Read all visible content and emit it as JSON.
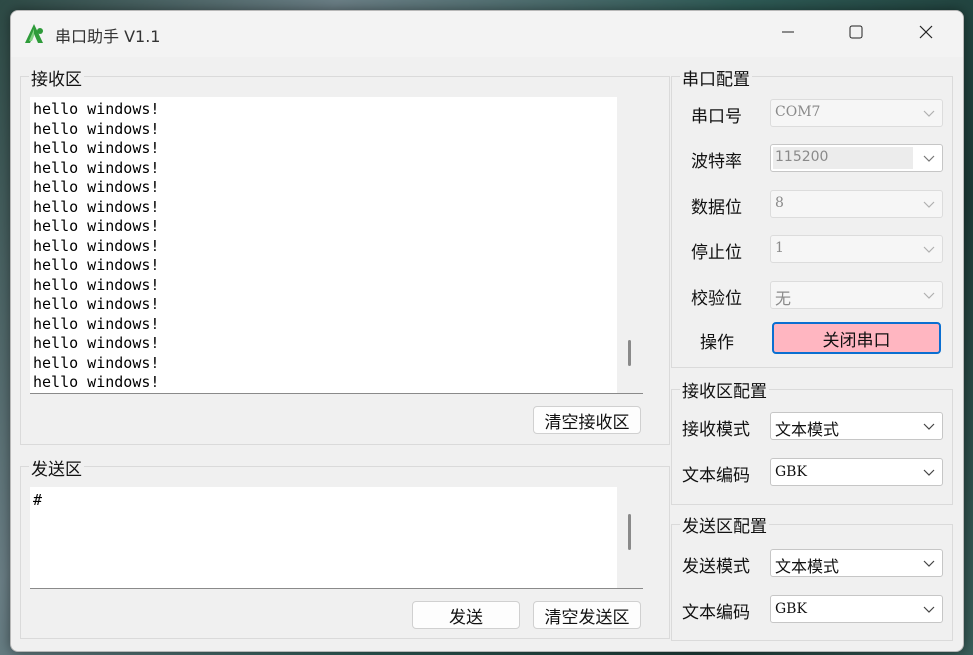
{
  "window": {
    "title": "串口助手 V1.1"
  },
  "receive": {
    "group_title": "接收区",
    "lines": [
      "hello windows!",
      "hello windows!",
      "hello windows!",
      "hello windows!",
      "hello windows!",
      "hello windows!",
      "hello windows!",
      "hello windows!",
      "hello windows!",
      "hello windows!",
      "hello windows!",
      "hello windows!",
      "hello windows!",
      "hello windows!",
      "hello windows!"
    ],
    "clear_button": "清空接收区"
  },
  "send": {
    "group_title": "发送区",
    "text": "#",
    "send_button": "发送",
    "clear_button": "清空发送区"
  },
  "serial_config": {
    "group_title": "串口配置",
    "port_label": "串口号",
    "port_value": "COM7",
    "baud_label": "波特率",
    "baud_value": "115200",
    "databits_label": "数据位",
    "databits_value": "8",
    "stopbits_label": "停止位",
    "stopbits_value": "1",
    "parity_label": "校验位",
    "parity_value": "无",
    "action_label": "操作",
    "action_button": "关闭串口"
  },
  "receive_config": {
    "group_title": "接收区配置",
    "mode_label": "接收模式",
    "mode_value": "文本模式",
    "encoding_label": "文本编码",
    "encoding_value": "GBK"
  },
  "send_config": {
    "group_title": "发送区配置",
    "mode_label": "发送模式",
    "mode_value": "文本模式",
    "encoding_label": "文本编码",
    "encoding_value": "GBK"
  },
  "colors": {
    "close_port_bg": "#ffb6c1",
    "focus_border": "#0a6fd1",
    "icon_green": "#2e9b3a"
  },
  "icons": [
    "app-logo-icon",
    "minimize-icon",
    "maximize-icon",
    "close-icon",
    "chevron-down-icon"
  ]
}
